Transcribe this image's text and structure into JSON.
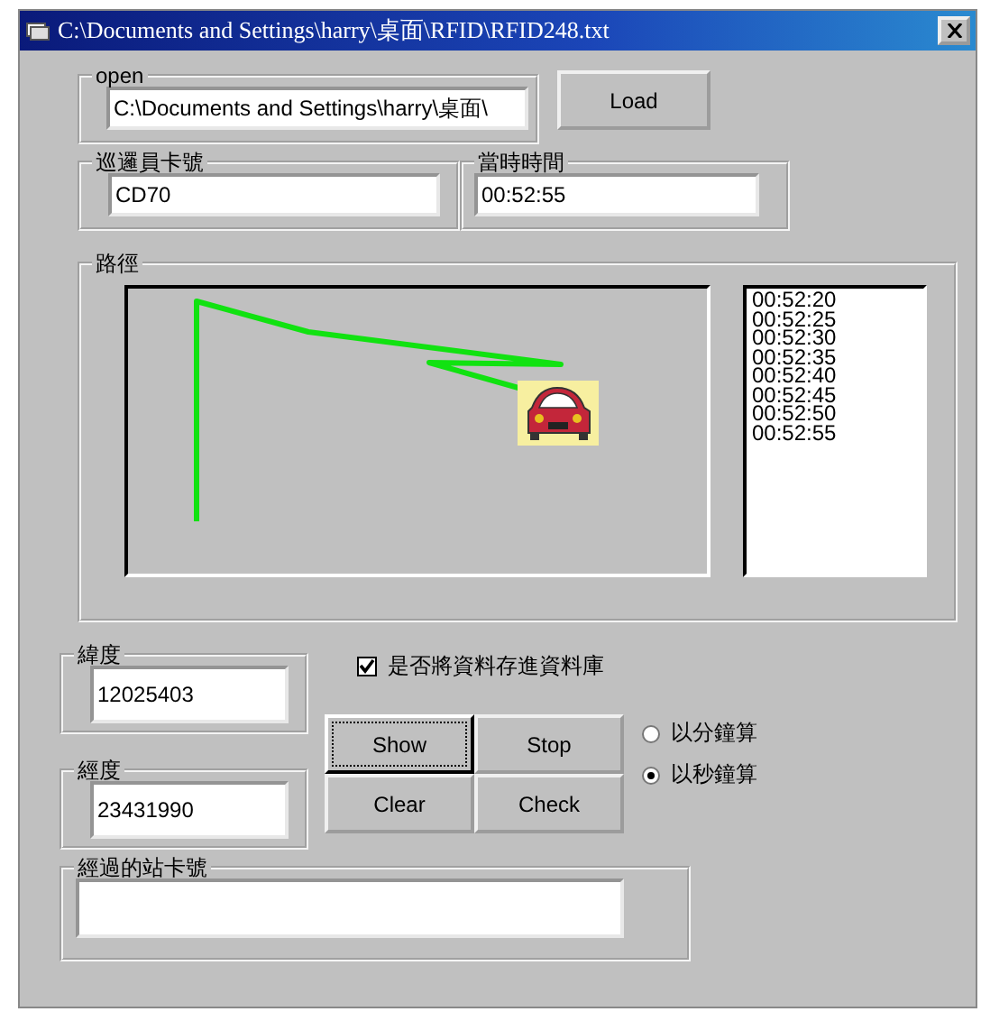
{
  "window": {
    "title": "C:\\Documents and Settings\\harry\\桌面\\RFID\\RFID248.txt"
  },
  "open": {
    "label": "open",
    "value": "C:\\Documents and Settings\\harry\\桌面\\"
  },
  "load_button": "Load",
  "card_number": {
    "label": "巡邏員卡號",
    "value": "CD70"
  },
  "current_time": {
    "label": "當時時間",
    "value": "00:52:55"
  },
  "route": {
    "label": "路徑",
    "times": [
      "00:52:20",
      "00:52:25",
      "00:52:30",
      "00:52:35",
      "00:52:40",
      "00:52:45",
      "00:52:50",
      "00:52:55"
    ]
  },
  "latitude": {
    "label": "緯度",
    "value": "12025403"
  },
  "longitude": {
    "label": "經度",
    "value": "23431990"
  },
  "save_to_db": {
    "label": "是否將資料存進資料庫",
    "checked": true
  },
  "buttons": [
    {
      "label": "Show",
      "focused": true
    },
    {
      "label": "Stop",
      "focused": false
    },
    {
      "label": "Clear",
      "focused": false
    },
    {
      "label": "Check",
      "focused": false
    }
  ],
  "mode": [
    {
      "label": "以分鐘算",
      "selected": false
    },
    {
      "label": "以秒鐘算",
      "selected": true
    }
  ],
  "stations": {
    "label": "經過的站卡號"
  }
}
